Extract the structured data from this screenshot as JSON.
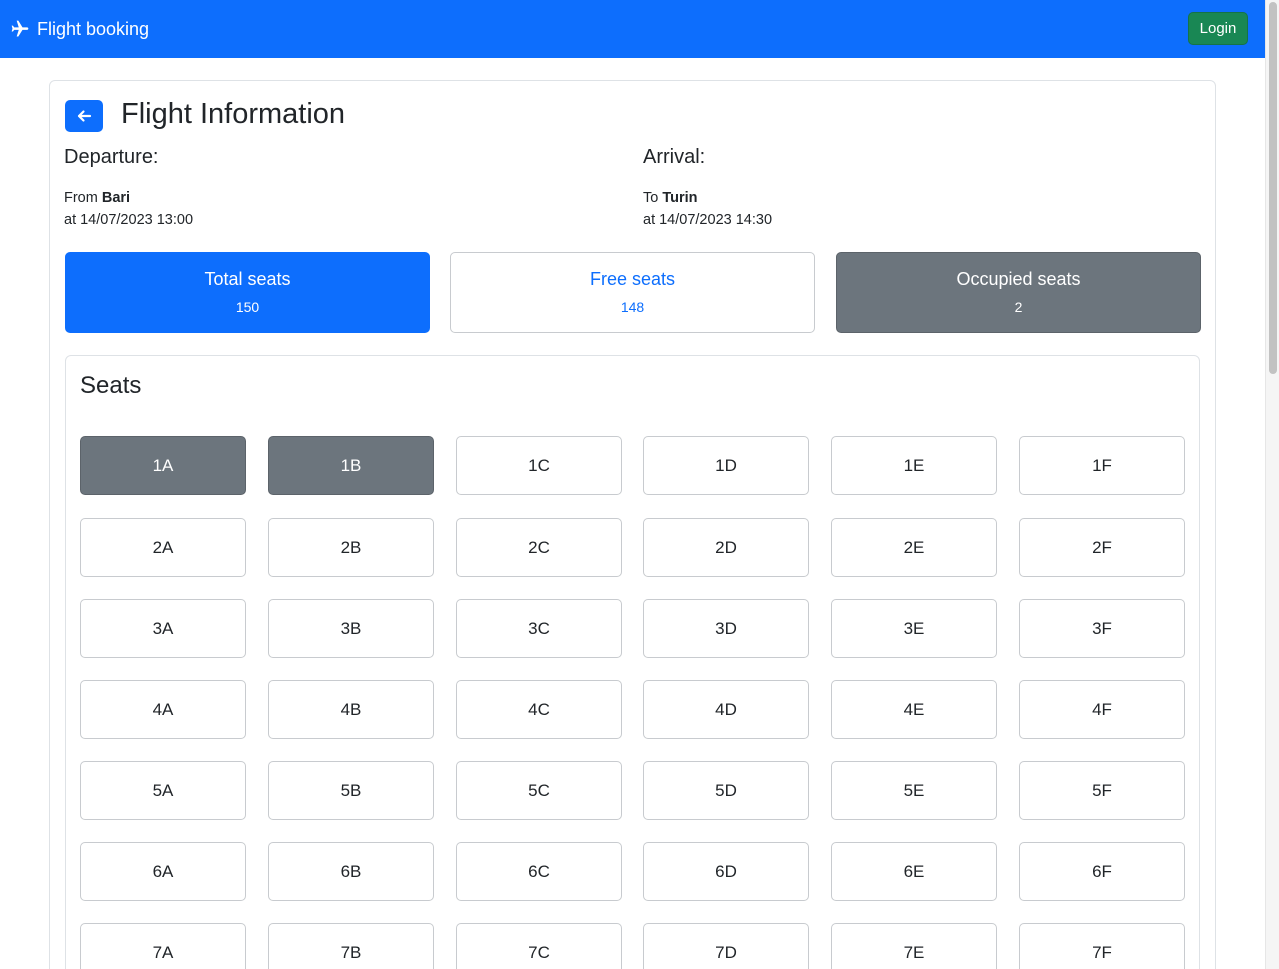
{
  "navbar": {
    "brand": "Flight booking",
    "brand_icon": "airplane-icon",
    "login_label": "Login",
    "color": "#0d6efd"
  },
  "page": {
    "title": "Flight Information"
  },
  "departure": {
    "heading": "Departure:",
    "from_prefix": "From",
    "city": "Bari",
    "datetime": "at 14/07/2023 13:00"
  },
  "arrival": {
    "heading": "Arrival:",
    "to_prefix": "To",
    "city": "Turin",
    "datetime": "at 14/07/2023 14:30"
  },
  "stats": {
    "total": {
      "label": "Total seats",
      "value": "150"
    },
    "free": {
      "label": "Free seats",
      "value": "148"
    },
    "occupied": {
      "label": "Occupied seats",
      "value": "2"
    }
  },
  "seats": {
    "title": "Seats",
    "rows": [
      [
        {
          "label": "1A",
          "occupied": true
        },
        {
          "label": "1B",
          "occupied": true
        },
        {
          "label": "1C",
          "occupied": false
        },
        {
          "label": "1D",
          "occupied": false
        },
        {
          "label": "1E",
          "occupied": false
        },
        {
          "label": "1F",
          "occupied": false
        }
      ],
      [
        {
          "label": "2A",
          "occupied": false
        },
        {
          "label": "2B",
          "occupied": false
        },
        {
          "label": "2C",
          "occupied": false
        },
        {
          "label": "2D",
          "occupied": false
        },
        {
          "label": "2E",
          "occupied": false
        },
        {
          "label": "2F",
          "occupied": false
        }
      ],
      [
        {
          "label": "3A",
          "occupied": false
        },
        {
          "label": "3B",
          "occupied": false
        },
        {
          "label": "3C",
          "occupied": false
        },
        {
          "label": "3D",
          "occupied": false
        },
        {
          "label": "3E",
          "occupied": false
        },
        {
          "label": "3F",
          "occupied": false
        }
      ],
      [
        {
          "label": "4A",
          "occupied": false
        },
        {
          "label": "4B",
          "occupied": false
        },
        {
          "label": "4C",
          "occupied": false
        },
        {
          "label": "4D",
          "occupied": false
        },
        {
          "label": "4E",
          "occupied": false
        },
        {
          "label": "4F",
          "occupied": false
        }
      ],
      [
        {
          "label": "5A",
          "occupied": false
        },
        {
          "label": "5B",
          "occupied": false
        },
        {
          "label": "5C",
          "occupied": false
        },
        {
          "label": "5D",
          "occupied": false
        },
        {
          "label": "5E",
          "occupied": false
        },
        {
          "label": "5F",
          "occupied": false
        }
      ],
      [
        {
          "label": "6A",
          "occupied": false
        },
        {
          "label": "6B",
          "occupied": false
        },
        {
          "label": "6C",
          "occupied": false
        },
        {
          "label": "6D",
          "occupied": false
        },
        {
          "label": "6E",
          "occupied": false
        },
        {
          "label": "6F",
          "occupied": false
        }
      ],
      [
        {
          "label": "7A",
          "occupied": false
        },
        {
          "label": "7B",
          "occupied": false
        },
        {
          "label": "7C",
          "occupied": false
        },
        {
          "label": "7D",
          "occupied": false
        },
        {
          "label": "7E",
          "occupied": false
        },
        {
          "label": "7F",
          "occupied": false
        }
      ]
    ]
  }
}
